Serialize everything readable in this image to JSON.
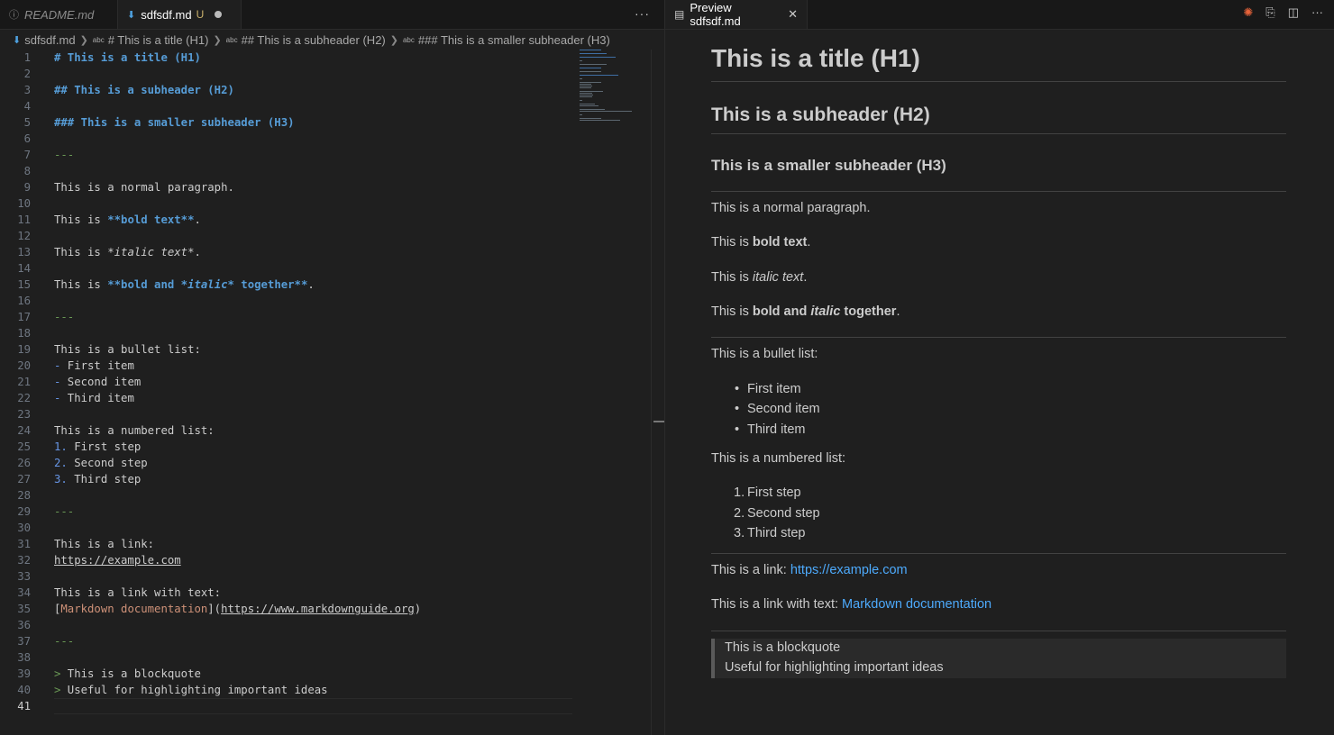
{
  "tabs": {
    "readme": "README.md",
    "active": "sdfsdf.md",
    "active_status": "U",
    "more": "···"
  },
  "breadcrumb": {
    "file": "sdfsdf.md",
    "h1": "# This is a title (H1)",
    "h2": "## This is a subheader (H2)",
    "h3": "### This is a smaller subheader (H3)",
    "abc": "abc"
  },
  "editor_lines": [
    {
      "n": "1",
      "segs": [
        {
          "t": "# This is a title (H1)",
          "c": "c-h"
        }
      ]
    },
    {
      "n": "2",
      "segs": []
    },
    {
      "n": "3",
      "segs": [
        {
          "t": "## This is a subheader (H2)",
          "c": "c-h"
        }
      ]
    },
    {
      "n": "4",
      "segs": []
    },
    {
      "n": "5",
      "segs": [
        {
          "t": "### This is a smaller subheader (H3)",
          "c": "c-h"
        }
      ]
    },
    {
      "n": "6",
      "segs": []
    },
    {
      "n": "7",
      "segs": [
        {
          "t": "---",
          "c": "c-hr"
        }
      ]
    },
    {
      "n": "8",
      "segs": []
    },
    {
      "n": "9",
      "segs": [
        {
          "t": "This is a normal paragraph.",
          "c": ""
        }
      ]
    },
    {
      "n": "10",
      "segs": []
    },
    {
      "n": "11",
      "segs": [
        {
          "t": "This is ",
          "c": ""
        },
        {
          "t": "**bold text**",
          "c": "c-b"
        },
        {
          "t": ".",
          "c": ""
        }
      ]
    },
    {
      "n": "12",
      "segs": []
    },
    {
      "n": "13",
      "segs": [
        {
          "t": "This is ",
          "c": ""
        },
        {
          "t": "*italic text*",
          "c": "c-i"
        },
        {
          "t": ".",
          "c": ""
        }
      ]
    },
    {
      "n": "14",
      "segs": []
    },
    {
      "n": "15",
      "segs": [
        {
          "t": "This is ",
          "c": ""
        },
        {
          "t": "**bold and ",
          "c": "c-b"
        },
        {
          "t": "*italic*",
          "c": "c-bi"
        },
        {
          "t": " together**",
          "c": "c-b"
        },
        {
          "t": ".",
          "c": ""
        }
      ]
    },
    {
      "n": "16",
      "segs": []
    },
    {
      "n": "17",
      "segs": [
        {
          "t": "---",
          "c": "c-hr"
        }
      ]
    },
    {
      "n": "18",
      "segs": []
    },
    {
      "n": "19",
      "segs": [
        {
          "t": "This is a bullet list:",
          "c": ""
        }
      ]
    },
    {
      "n": "20",
      "segs": [
        {
          "t": "-",
          "c": "c-mk"
        },
        {
          "t": " First item",
          "c": ""
        }
      ]
    },
    {
      "n": "21",
      "segs": [
        {
          "t": "-",
          "c": "c-mk"
        },
        {
          "t": " Second item",
          "c": ""
        }
      ]
    },
    {
      "n": "22",
      "segs": [
        {
          "t": "-",
          "c": "c-mk"
        },
        {
          "t": " Third item",
          "c": ""
        }
      ]
    },
    {
      "n": "23",
      "segs": []
    },
    {
      "n": "24",
      "segs": [
        {
          "t": "This is a numbered list:",
          "c": ""
        }
      ]
    },
    {
      "n": "25",
      "segs": [
        {
          "t": "1.",
          "c": "c-mk"
        },
        {
          "t": " First step",
          "c": ""
        }
      ]
    },
    {
      "n": "26",
      "segs": [
        {
          "t": "2.",
          "c": "c-mk"
        },
        {
          "t": " Second step",
          "c": ""
        }
      ]
    },
    {
      "n": "27",
      "segs": [
        {
          "t": "3.",
          "c": "c-mk"
        },
        {
          "t": " Third step",
          "c": ""
        }
      ]
    },
    {
      "n": "28",
      "segs": []
    },
    {
      "n": "29",
      "segs": [
        {
          "t": "---",
          "c": "c-hr"
        }
      ]
    },
    {
      "n": "30",
      "segs": []
    },
    {
      "n": "31",
      "segs": [
        {
          "t": "This is a link:",
          "c": ""
        }
      ]
    },
    {
      "n": "32",
      "segs": [
        {
          "t": "https://example.com",
          "c": "c-link"
        }
      ]
    },
    {
      "n": "33",
      "segs": []
    },
    {
      "n": "34",
      "segs": [
        {
          "t": "This is a link with text:",
          "c": ""
        }
      ]
    },
    {
      "n": "35",
      "segs": [
        {
          "t": "[",
          "c": ""
        },
        {
          "t": "Markdown documentation",
          "c": "c-lt"
        },
        {
          "t": "](",
          "c": ""
        },
        {
          "t": "https://www.markdownguide.org",
          "c": "c-link"
        },
        {
          "t": ")",
          "c": ""
        }
      ]
    },
    {
      "n": "36",
      "segs": []
    },
    {
      "n": "37",
      "segs": [
        {
          "t": "---",
          "c": "c-hr"
        }
      ]
    },
    {
      "n": "38",
      "segs": []
    },
    {
      "n": "39",
      "segs": [
        {
          "t": ">",
          "c": "c-q"
        },
        {
          "t": " This is a blockquote",
          "c": ""
        }
      ]
    },
    {
      "n": "40",
      "segs": [
        {
          "t": ">",
          "c": "c-q"
        },
        {
          "t": " Useful for highlighting important ideas",
          "c": ""
        }
      ]
    },
    {
      "n": "41",
      "segs": []
    }
  ],
  "current_line": "41",
  "preview_tab": {
    "title": "Preview sdfsdf.md"
  },
  "preview": {
    "h1": "This is a title (H1)",
    "h2": "This is a subheader (H2)",
    "h3": "This is a smaller subheader (H3)",
    "para": "This is a normal paragraph.",
    "bold_pre": "This is ",
    "bold": "bold text",
    "bold_post": ".",
    "italic_pre": "This is ",
    "italic": "italic text",
    "italic_post": ".",
    "bi_pre": "This is ",
    "bi_a": "bold and ",
    "bi_b": "italic",
    "bi_c": " together",
    "bi_post": ".",
    "bullet_intro": "This is a bullet list:",
    "bullets": [
      "First item",
      "Second item",
      "Third item"
    ],
    "num_intro": "This is a numbered list:",
    "numbers": [
      "1.",
      "2.",
      "3."
    ],
    "steps": [
      "First step",
      "Second step",
      "Third step"
    ],
    "link_pre": "This is a link: ",
    "link": "https://example.com",
    "link2_pre": "This is a link with text: ",
    "link2": "Markdown documentation",
    "quote1": "This is a blockquote",
    "quote2": "Useful for highlighting important ideas"
  },
  "colors": {
    "heading": "#569cd6",
    "link": "#4daafc",
    "link_text": "#ce9178",
    "rule": "#6a9955"
  }
}
